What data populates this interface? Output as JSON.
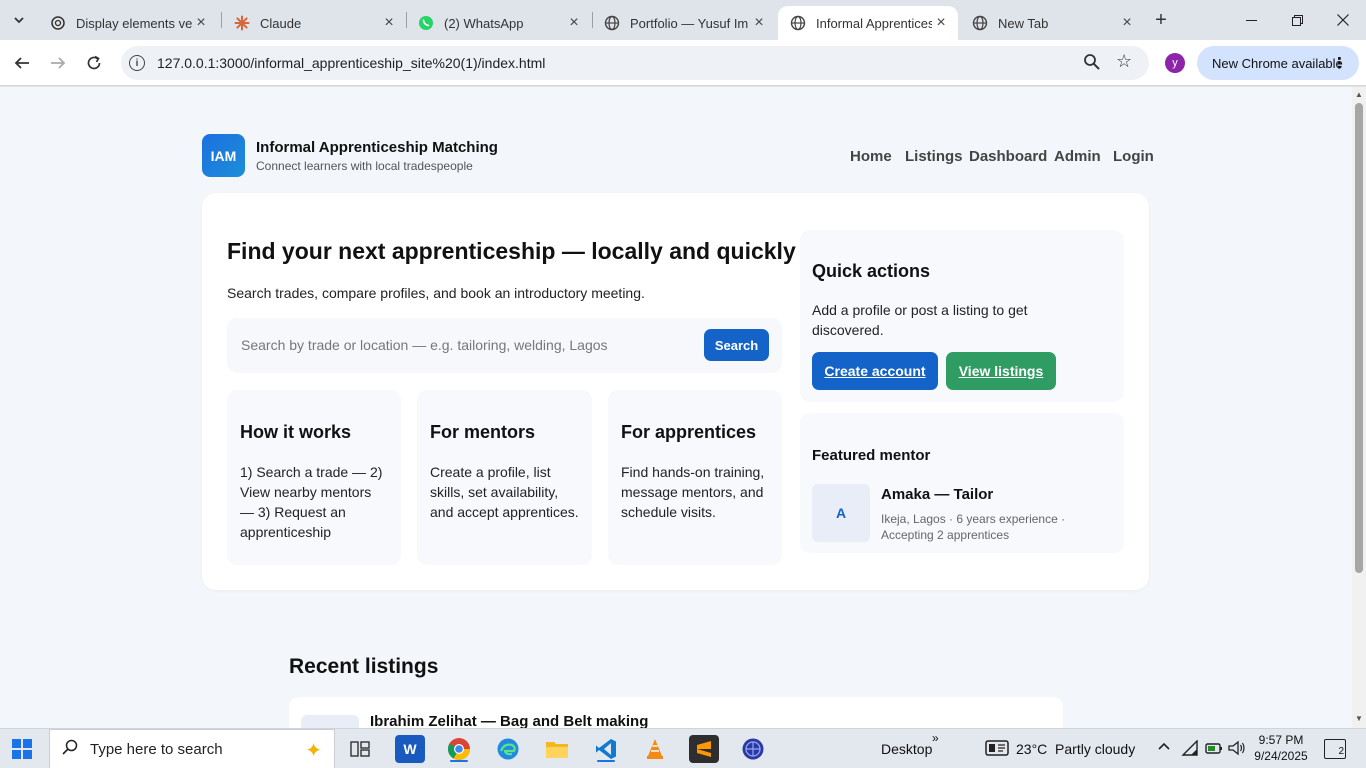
{
  "browser": {
    "tabs": [
      {
        "title": "Display elements vert",
        "active": false
      },
      {
        "title": "Claude",
        "active": false
      },
      {
        "title": "(2) WhatsApp",
        "active": false
      },
      {
        "title": "Portfolio — Yusuf Im",
        "active": false
      },
      {
        "title": "Informal Apprentices",
        "active": true
      },
      {
        "title": "New Tab",
        "active": false
      }
    ],
    "url": "127.0.0.1:3000/informal_apprenticeship_site%20(1)/index.html",
    "profile_initial": "y",
    "update_label": "New Chrome available"
  },
  "site": {
    "logo_text": "IAM",
    "title": "Informal Apprenticeship Matching",
    "tagline": "Connect learners with local tradespeople",
    "nav": [
      "Home",
      "Listings",
      "Dashboard",
      "Admin",
      "Login"
    ]
  },
  "hero": {
    "title": "Find your next apprenticeship — locally and quickly",
    "subtitle": "Search trades, compare profiles, and book an introductory meeting.",
    "search_placeholder": "Search by trade or location — e.g. tailoring, welding, Lagos",
    "search_button": "Search"
  },
  "info_cards": [
    {
      "title": "How it works",
      "text": "1) Search a trade — 2) View nearby mentors — 3) Request an apprenticeship"
    },
    {
      "title": "For mentors",
      "text": "Create a profile, list skills, set availability, and accept apprentices."
    },
    {
      "title": "For apprentices",
      "text": "Find hands-on training, message mentors, and schedule visits."
    }
  ],
  "quick_actions": {
    "title": "Quick actions",
    "text": "Add a profile or post a listing to get discovered.",
    "create_label": "Create account",
    "view_label": "View listings"
  },
  "featured_mentor": {
    "heading": "Featured mentor",
    "initial": "A",
    "name": "Amaka — Tailor",
    "meta": "Ikeja, Lagos · 6 years experience · Accepting 2 apprentices"
  },
  "recent": {
    "title": "Recent listings",
    "items": [
      {
        "title": "Ibrahim Zelihat — Bag and Belt making"
      }
    ]
  },
  "taskbar": {
    "search_text": "Type here to search",
    "desktop_label": "Desktop",
    "weather": "23°C  Partly cloudy",
    "time": "9:57 PM",
    "date": "9/24/2025",
    "notification_count": "2"
  },
  "colors": {
    "primary": "#1463c8",
    "success": "#2f9d63",
    "page_bg": "#f3f6fa"
  }
}
